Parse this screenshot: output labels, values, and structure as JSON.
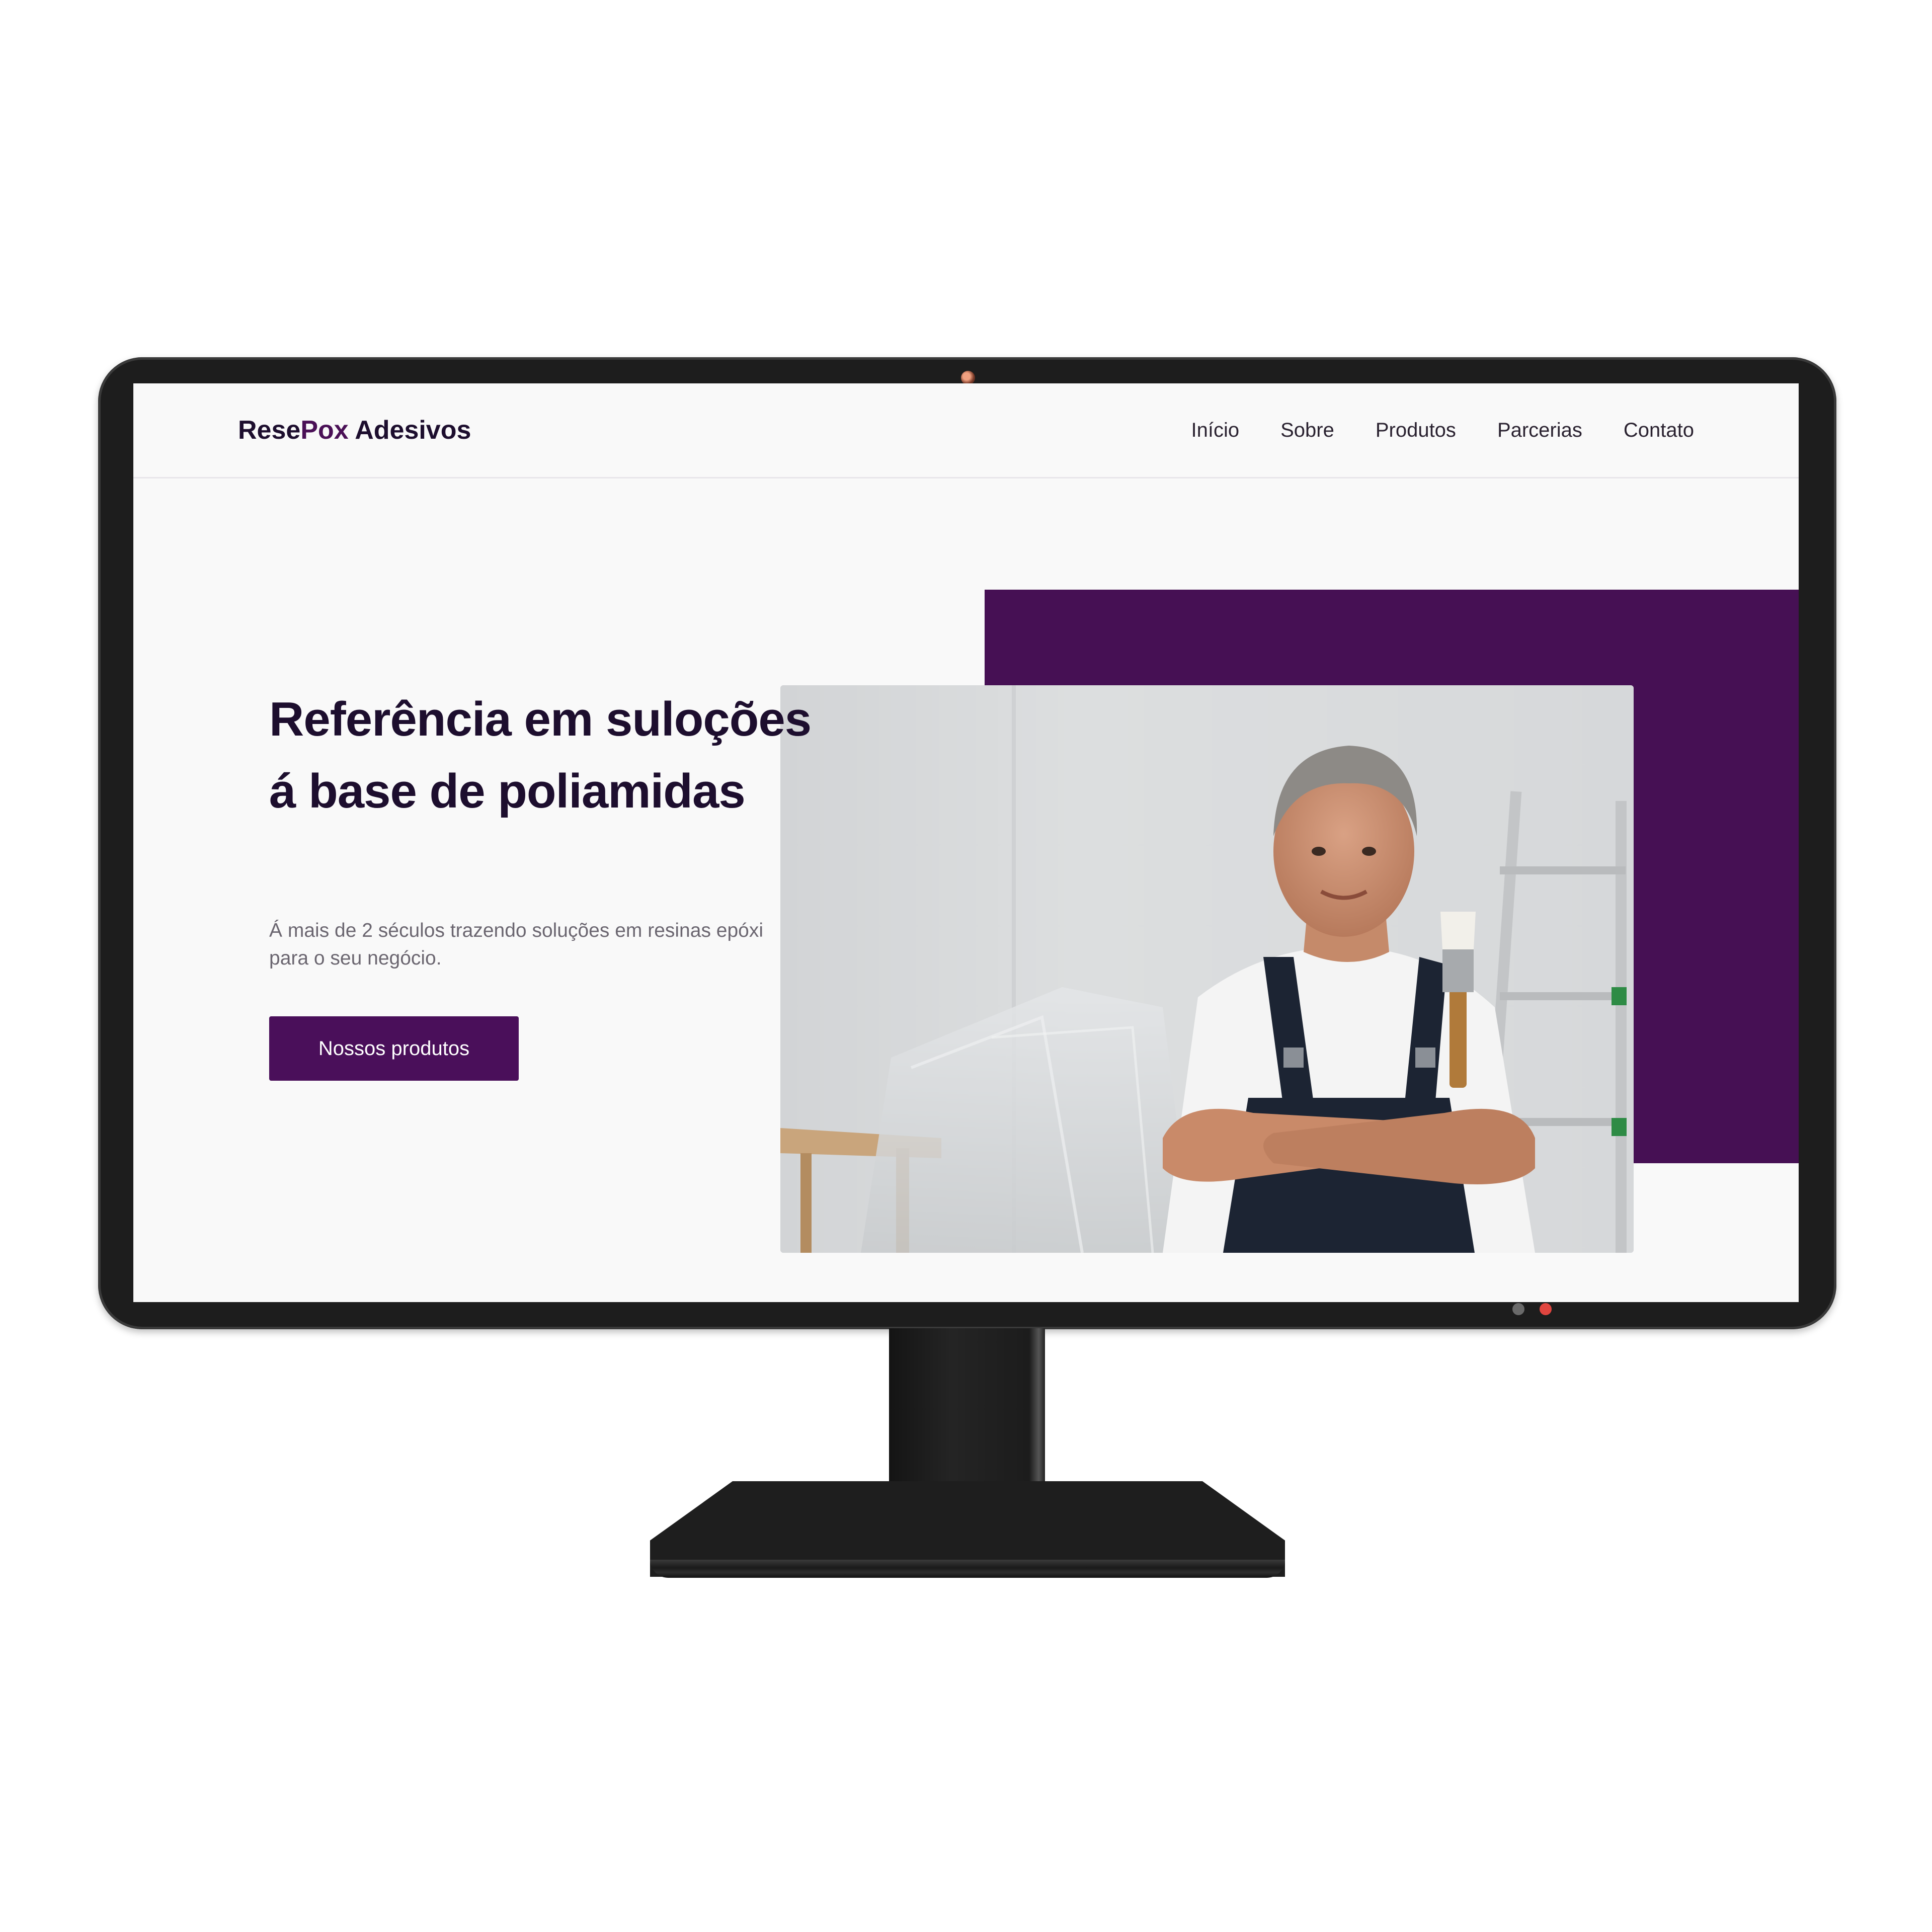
{
  "site": {
    "logo_primary": "Rese",
    "logo_accent": "Pox",
    "logo_rest": " Adesivos"
  },
  "nav": {
    "items": [
      {
        "label": "Início"
      },
      {
        "label": "Sobre"
      },
      {
        "label": "Produtos"
      },
      {
        "label": "Parcerias"
      },
      {
        "label": "Contato"
      }
    ]
  },
  "hero": {
    "title": "Referência em suloções á base de poliamidas",
    "subtitle": "Á mais de 2 séculos trazendo soluções em resinas epóxi para o seu negócio.",
    "cta_label": "Nossos produtos",
    "image_icon": "worker-photo"
  },
  "colors": {
    "brand_purple": "#461054",
    "heading_dark": "#1d0e2e",
    "page_bg": "#f9f9f9"
  }
}
